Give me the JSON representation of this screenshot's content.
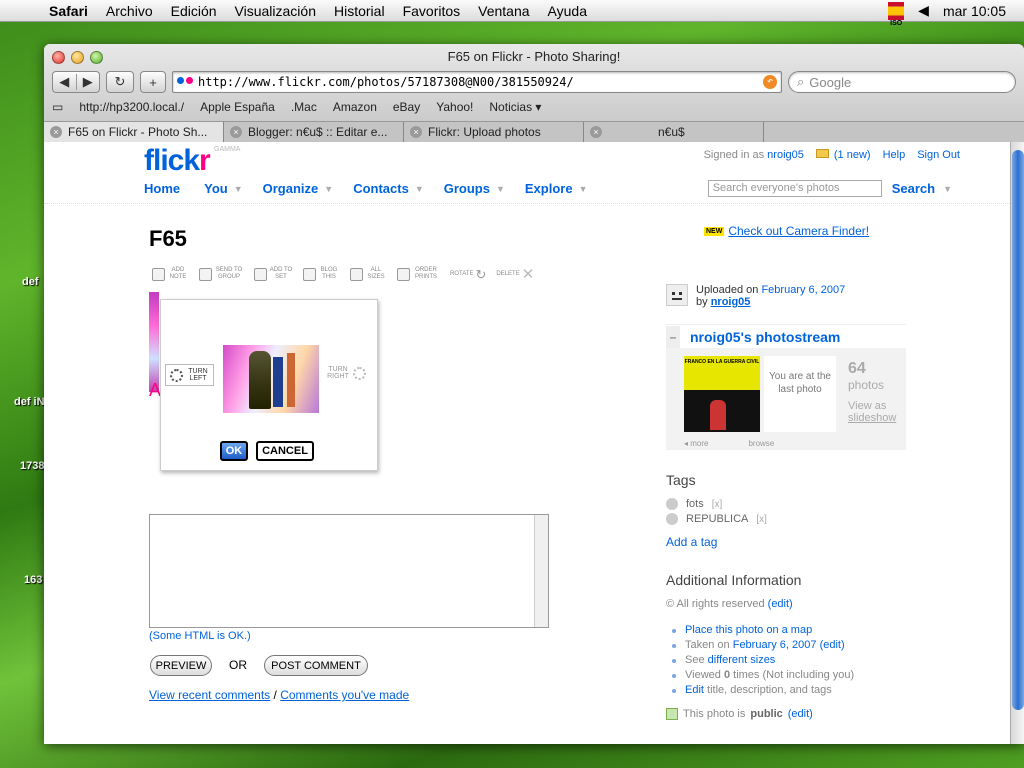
{
  "menubar": {
    "app": "Safari",
    "items": [
      "Archivo",
      "Edición",
      "Visualización",
      "Historial",
      "Favoritos",
      "Ventana",
      "Ayuda"
    ],
    "input_method": "ISO",
    "clock": "mar 10:05"
  },
  "desktop": {
    "labels": [
      "def",
      "def iN",
      "1738",
      "163"
    ]
  },
  "window": {
    "title": "F65 on Flickr - Photo Sharing!",
    "url": "http://www.flickr.com/photos/57187308@N00/381550924/",
    "search_placeholder": "Google",
    "bookmarks": [
      "http://hp3200.local./",
      "Apple España",
      ".Mac",
      "Amazon",
      "eBay",
      "Yahoo!",
      "Noticias ▾"
    ],
    "tabs": [
      {
        "label": "F65 on Flickr - Photo Sh..."
      },
      {
        "label": "Blogger: n€u$ :: Editar e..."
      },
      {
        "label": "Flickr: Upload photos"
      },
      {
        "label": "n€u$"
      }
    ]
  },
  "flickr": {
    "logo_first": "flick",
    "logo_last": "r",
    "gamma": "GAMMA",
    "signed_in": "Signed in as",
    "username": "nroig05",
    "new_mail": "(1 new)",
    "help": "Help",
    "sign_out": "Sign Out",
    "nav": [
      "Home",
      "You",
      "Organize",
      "Contacts",
      "Groups",
      "Explore"
    ],
    "search_placeholder": "Search everyone's photos",
    "search_button": "Search"
  },
  "photo": {
    "title": "F65",
    "tools": [
      "ADD NOTE",
      "SEND TO GROUP",
      "ADD TO SET",
      "BLOG THIS",
      "ALL SIZES",
      "ORDER PRINTS",
      "ROTATE",
      "DELETE"
    ]
  },
  "rotate": {
    "left": "TURN LEFT",
    "right": "TURN RIGHT",
    "ok": "OK",
    "cancel": "CANCEL"
  },
  "comment": {
    "heading_partial": "A",
    "html_ok": "(Some HTML is OK.)",
    "preview": "PREVIEW",
    "or": "OR",
    "post": "POST COMMENT",
    "recent": "View recent comments",
    "sep": " / ",
    "yours": "Comments you've made"
  },
  "sidebar": {
    "camera_new": "NEW",
    "camera_link": "Check out Camera Finder!",
    "uploaded_on": "Uploaded on",
    "upload_date": "February 6, 2007",
    "by": "by",
    "photostream": "nroig05's photostream",
    "stream_thumb_text": "FRANCO EN LA GUERRA CIVIL",
    "last_photo": "You are at the last photo",
    "photo_count": "64",
    "photos_label": "photos",
    "view_as": "View as",
    "slideshow": "slideshow",
    "more": "◂ more",
    "browse": "browse",
    "tags_heading": "Tags",
    "tags": [
      {
        "name": "fots",
        "x": "[x]"
      },
      {
        "name": "REPUBLICA",
        "x": "[x]"
      }
    ],
    "add_tag": "Add a tag",
    "addinfo_heading": "Additional Information",
    "rights": "© All rights reserved",
    "edit": "(edit)",
    "info": {
      "map": "Place this photo on a map",
      "taken": "Taken on",
      "taken_date": "February 6, 2007",
      "see": "See",
      "sizes": "different sizes",
      "viewed_pre": "Viewed",
      "viewed_count": "0",
      "viewed_post": "times  (Not including you)",
      "edit_link": "Edit",
      "edit_rest": "title, description, and tags"
    },
    "public_pre": "This photo is",
    "public": "public"
  }
}
